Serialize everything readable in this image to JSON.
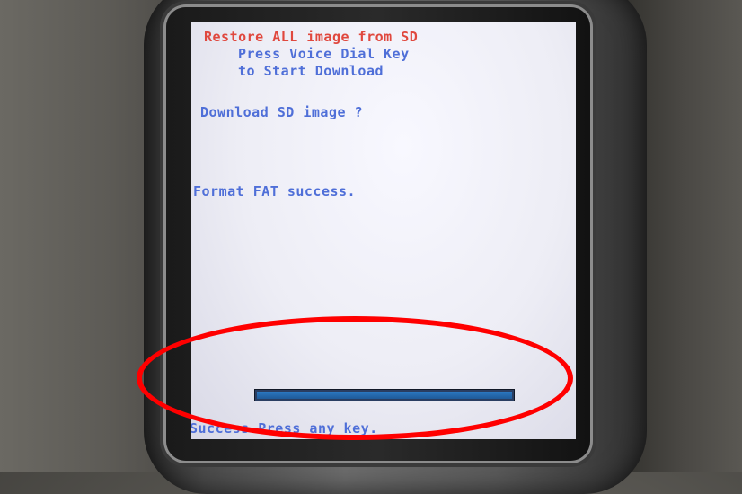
{
  "screen": {
    "lines": [
      {
        "text": "Restore ALL image from SD",
        "color": "#e0483e"
      },
      {
        "text": "Press Voice Dial Key",
        "color": "#4f6fd8"
      },
      {
        "text": "to Start Download",
        "color": "#4f6fd8"
      },
      {
        "text": "Download SD image ?",
        "color": "#4f6fd8"
      },
      {
        "text": "Format FAT success.",
        "color": "#4f6fd8"
      }
    ],
    "progress": {
      "fraction": 1.0
    },
    "status_text": "Success.Press any key."
  },
  "annotation": {
    "color": "#ff0000"
  }
}
